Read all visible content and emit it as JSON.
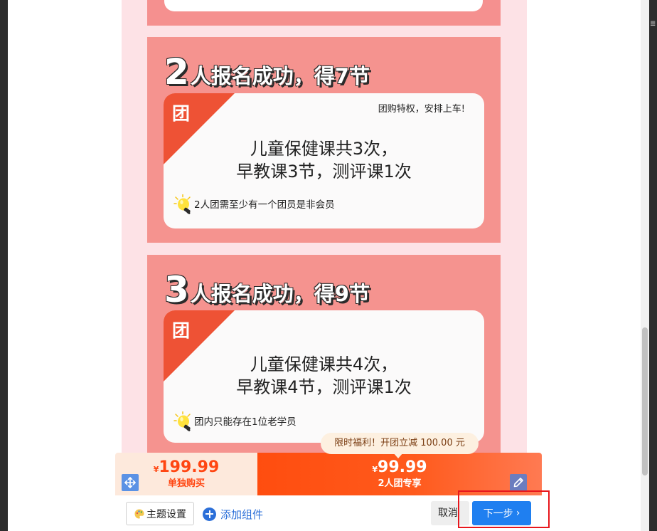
{
  "cards": [
    {
      "heading_number": "2",
      "heading_text": "人报名成功，得7节",
      "tag_char": "团",
      "privilege": "团购特权，安排上车!",
      "line1": "儿童保健课共3次，",
      "line2": "早教课3节，测评课1次",
      "tip": "2人团需至少有一个团员是非会员"
    },
    {
      "heading_number": "3",
      "heading_text": "人报名成功，得9节",
      "tag_char": "团",
      "line1": "儿童保健课共4次，",
      "line2": "早教课4节，测评课1次",
      "tip": "团内只能存在1位老学员"
    }
  ],
  "promo": {
    "text": "限时福利！开团立减 100.00 元"
  },
  "buybar": {
    "single": {
      "currency": "¥",
      "price": "199.99",
      "label": "单独购买"
    },
    "group": {
      "currency": "¥",
      "price": "99.99",
      "label": "2人团专享"
    }
  },
  "toolbar": {
    "theme_label": "主题设置",
    "add_label": "添加组件",
    "cancel_label": "取消",
    "next_label": "下一步",
    "next_chevron": "›"
  },
  "frame": {
    "edge_glyph": "≣"
  },
  "colors": {
    "canvas": "#fde2e6",
    "card": "#f5938f",
    "tag": "#ee5235",
    "group_price_bg": "#ff4d0f",
    "single_price_bg": "#fde9dc",
    "primary": "#1f7ff0",
    "highlight": "#e8161c"
  }
}
